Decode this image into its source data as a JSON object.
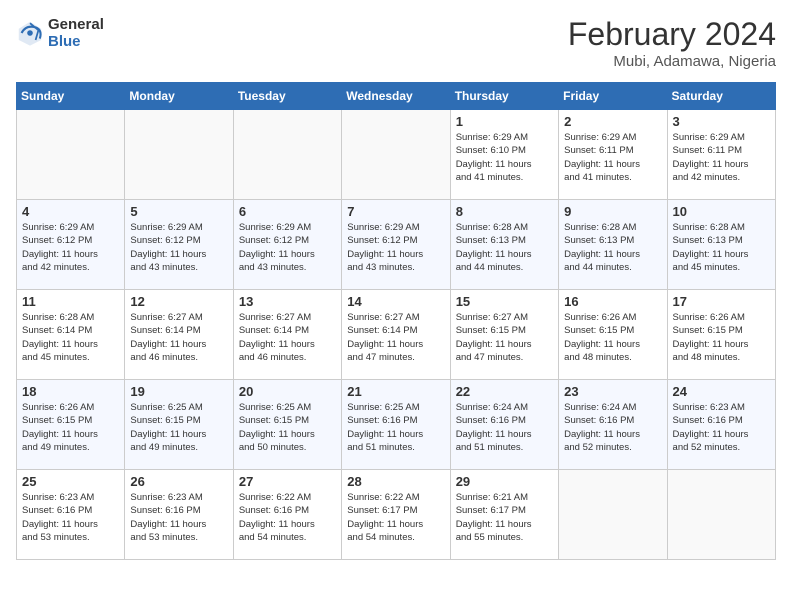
{
  "header": {
    "logo_general": "General",
    "logo_blue": "Blue",
    "month_year": "February 2024",
    "location": "Mubi, Adamawa, Nigeria"
  },
  "days_of_week": [
    "Sunday",
    "Monday",
    "Tuesday",
    "Wednesday",
    "Thursday",
    "Friday",
    "Saturday"
  ],
  "weeks": [
    [
      {
        "day": "",
        "info": "",
        "empty": true
      },
      {
        "day": "",
        "info": "",
        "empty": true
      },
      {
        "day": "",
        "info": "",
        "empty": true
      },
      {
        "day": "",
        "info": "",
        "empty": true
      },
      {
        "day": "1",
        "info": "Sunrise: 6:29 AM\nSunset: 6:10 PM\nDaylight: 11 hours\nand 41 minutes.",
        "empty": false
      },
      {
        "day": "2",
        "info": "Sunrise: 6:29 AM\nSunset: 6:11 PM\nDaylight: 11 hours\nand 41 minutes.",
        "empty": false
      },
      {
        "day": "3",
        "info": "Sunrise: 6:29 AM\nSunset: 6:11 PM\nDaylight: 11 hours\nand 42 minutes.",
        "empty": false
      }
    ],
    [
      {
        "day": "4",
        "info": "Sunrise: 6:29 AM\nSunset: 6:12 PM\nDaylight: 11 hours\nand 42 minutes.",
        "empty": false
      },
      {
        "day": "5",
        "info": "Sunrise: 6:29 AM\nSunset: 6:12 PM\nDaylight: 11 hours\nand 43 minutes.",
        "empty": false
      },
      {
        "day": "6",
        "info": "Sunrise: 6:29 AM\nSunset: 6:12 PM\nDaylight: 11 hours\nand 43 minutes.",
        "empty": false
      },
      {
        "day": "7",
        "info": "Sunrise: 6:29 AM\nSunset: 6:12 PM\nDaylight: 11 hours\nand 43 minutes.",
        "empty": false
      },
      {
        "day": "8",
        "info": "Sunrise: 6:28 AM\nSunset: 6:13 PM\nDaylight: 11 hours\nand 44 minutes.",
        "empty": false
      },
      {
        "day": "9",
        "info": "Sunrise: 6:28 AM\nSunset: 6:13 PM\nDaylight: 11 hours\nand 44 minutes.",
        "empty": false
      },
      {
        "day": "10",
        "info": "Sunrise: 6:28 AM\nSunset: 6:13 PM\nDaylight: 11 hours\nand 45 minutes.",
        "empty": false
      }
    ],
    [
      {
        "day": "11",
        "info": "Sunrise: 6:28 AM\nSunset: 6:14 PM\nDaylight: 11 hours\nand 45 minutes.",
        "empty": false
      },
      {
        "day": "12",
        "info": "Sunrise: 6:27 AM\nSunset: 6:14 PM\nDaylight: 11 hours\nand 46 minutes.",
        "empty": false
      },
      {
        "day": "13",
        "info": "Sunrise: 6:27 AM\nSunset: 6:14 PM\nDaylight: 11 hours\nand 46 minutes.",
        "empty": false
      },
      {
        "day": "14",
        "info": "Sunrise: 6:27 AM\nSunset: 6:14 PM\nDaylight: 11 hours\nand 47 minutes.",
        "empty": false
      },
      {
        "day": "15",
        "info": "Sunrise: 6:27 AM\nSunset: 6:15 PM\nDaylight: 11 hours\nand 47 minutes.",
        "empty": false
      },
      {
        "day": "16",
        "info": "Sunrise: 6:26 AM\nSunset: 6:15 PM\nDaylight: 11 hours\nand 48 minutes.",
        "empty": false
      },
      {
        "day": "17",
        "info": "Sunrise: 6:26 AM\nSunset: 6:15 PM\nDaylight: 11 hours\nand 48 minutes.",
        "empty": false
      }
    ],
    [
      {
        "day": "18",
        "info": "Sunrise: 6:26 AM\nSunset: 6:15 PM\nDaylight: 11 hours\nand 49 minutes.",
        "empty": false
      },
      {
        "day": "19",
        "info": "Sunrise: 6:25 AM\nSunset: 6:15 PM\nDaylight: 11 hours\nand 49 minutes.",
        "empty": false
      },
      {
        "day": "20",
        "info": "Sunrise: 6:25 AM\nSunset: 6:15 PM\nDaylight: 11 hours\nand 50 minutes.",
        "empty": false
      },
      {
        "day": "21",
        "info": "Sunrise: 6:25 AM\nSunset: 6:16 PM\nDaylight: 11 hours\nand 51 minutes.",
        "empty": false
      },
      {
        "day": "22",
        "info": "Sunrise: 6:24 AM\nSunset: 6:16 PM\nDaylight: 11 hours\nand 51 minutes.",
        "empty": false
      },
      {
        "day": "23",
        "info": "Sunrise: 6:24 AM\nSunset: 6:16 PM\nDaylight: 11 hours\nand 52 minutes.",
        "empty": false
      },
      {
        "day": "24",
        "info": "Sunrise: 6:23 AM\nSunset: 6:16 PM\nDaylight: 11 hours\nand 52 minutes.",
        "empty": false
      }
    ],
    [
      {
        "day": "25",
        "info": "Sunrise: 6:23 AM\nSunset: 6:16 PM\nDaylight: 11 hours\nand 53 minutes.",
        "empty": false
      },
      {
        "day": "26",
        "info": "Sunrise: 6:23 AM\nSunset: 6:16 PM\nDaylight: 11 hours\nand 53 minutes.",
        "empty": false
      },
      {
        "day": "27",
        "info": "Sunrise: 6:22 AM\nSunset: 6:16 PM\nDaylight: 11 hours\nand 54 minutes.",
        "empty": false
      },
      {
        "day": "28",
        "info": "Sunrise: 6:22 AM\nSunset: 6:17 PM\nDaylight: 11 hours\nand 54 minutes.",
        "empty": false
      },
      {
        "day": "29",
        "info": "Sunrise: 6:21 AM\nSunset: 6:17 PM\nDaylight: 11 hours\nand 55 minutes.",
        "empty": false
      },
      {
        "day": "",
        "info": "",
        "empty": true
      },
      {
        "day": "",
        "info": "",
        "empty": true
      }
    ]
  ]
}
